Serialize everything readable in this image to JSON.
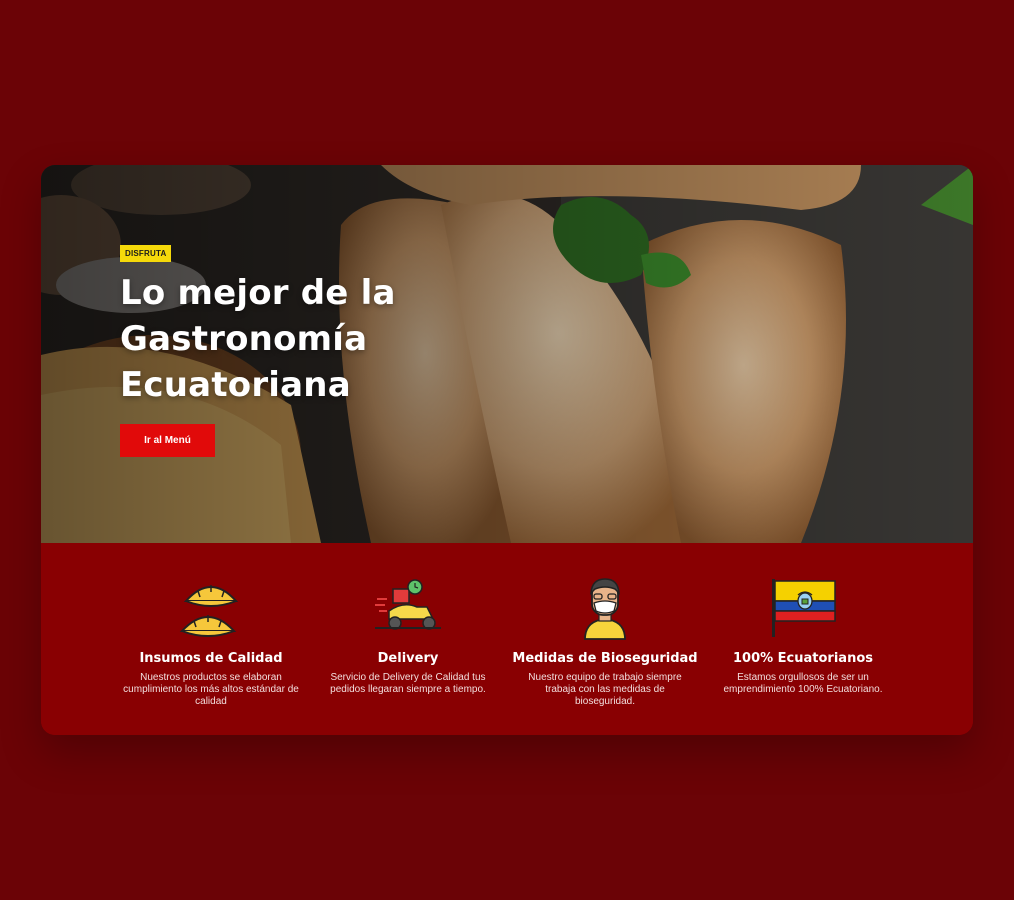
{
  "hero": {
    "tag": "DISFRUTA",
    "headline": "Lo mejor de la\nGastronomía\nEcuatoriana",
    "cta_label": "Ir al Menú"
  },
  "features": [
    {
      "icon": "empanadas-icon",
      "title": "Insumos de Calidad",
      "description": "Nuestros productos se elaboran cumplimiento los más altos estándar de calidad"
    },
    {
      "icon": "delivery-scooter-icon",
      "title": "Delivery",
      "description": "Servicio de Delivery de Calidad tus pedidos llegaran siempre a tiempo."
    },
    {
      "icon": "masked-person-icon",
      "title": "Medidas de Bioseguridad",
      "description": "Nuestro equipo de trabajo siempre trabaja con las medidas de bioseguridad."
    },
    {
      "icon": "ecuador-flag-icon",
      "title": "100% Ecuatorianos",
      "description": "Estamos orgullosos de ser un emprendimiento 100% Ecuatoriano."
    }
  ],
  "colors": {
    "page_background": "#6b0306",
    "features_background": "#890002",
    "tag_yellow": "#f5d90a",
    "cta_red": "#e10a0a"
  }
}
